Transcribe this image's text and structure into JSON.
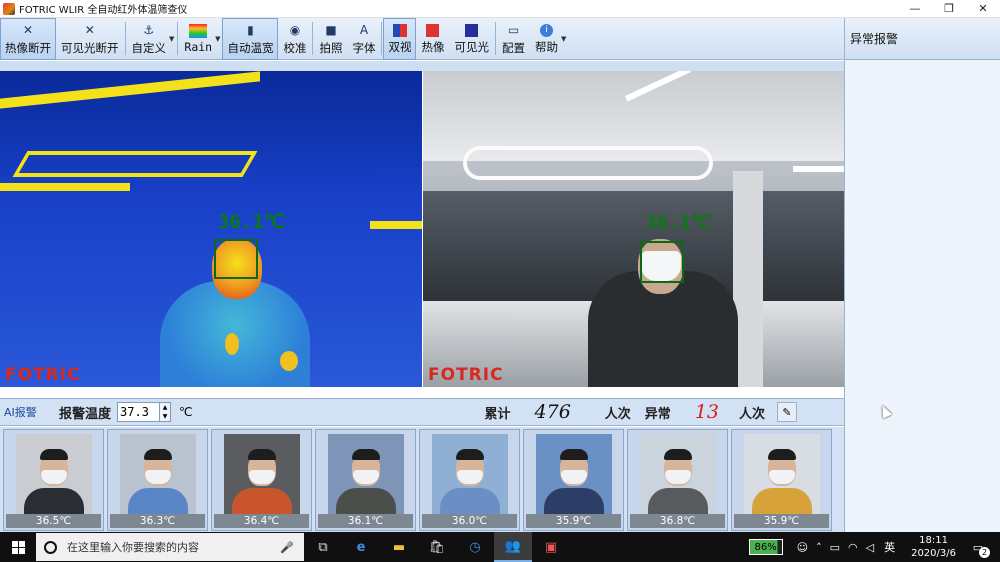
{
  "window": {
    "title": "FOTRIC WLIR 全自动红外体温筛查仪",
    "controls": [
      "—",
      "❐",
      "✕"
    ]
  },
  "toolbar": {
    "buttons": [
      {
        "label": "热像断开",
        "icon": "disconnect-icon",
        "active": true
      },
      {
        "label": "可见光断开",
        "icon": "disconnect-icon",
        "active": false
      },
      {
        "label": "自定义",
        "icon": "anchor-icon",
        "active": false
      },
      {
        "label": "Rain",
        "icon": "palette-rain-icon",
        "active": false
      },
      {
        "label": "自动温宽",
        "icon": "auto-span-icon",
        "active": true
      },
      {
        "label": "校准",
        "icon": "calibrate-icon",
        "active": false
      },
      {
        "label": "拍照",
        "icon": "camera-icon",
        "active": false
      },
      {
        "label": "字体",
        "icon": "font-icon",
        "active": false
      },
      {
        "label": "双视",
        "icon": "dual-view-icon",
        "active": true
      },
      {
        "label": "热像",
        "icon": "thermal-view-icon",
        "active": false
      },
      {
        "label": "可见光",
        "icon": "visible-view-icon",
        "active": false
      },
      {
        "label": "配置",
        "icon": "monitor-icon",
        "active": false
      },
      {
        "label": "帮助",
        "icon": "info-icon",
        "active": false
      }
    ]
  },
  "right_panel": {
    "title": "异常报警"
  },
  "thermal_view": {
    "temperature": "36.1℃",
    "brand": "FOTRIC"
  },
  "visible_view": {
    "temperature": "36.1℃",
    "brand": "FOTRIC"
  },
  "alarm": {
    "ai_label": "AI报警",
    "temp_label": "报警温度",
    "temp_value": "37.3",
    "temp_unit": "℃",
    "total_label": "累计",
    "total_count": "476",
    "count_unit": "人次",
    "abnormal_label": "异常",
    "abnormal_count": "13",
    "colors": {
      "total": "#111111",
      "abnormal": "#d81e1e"
    }
  },
  "captures": [
    {
      "temp": "36.5℃",
      "bg": "#c9ccd1",
      "clothes": "#2a2d33",
      "mask": true
    },
    {
      "temp": "36.3℃",
      "bg": "#b8c3cf",
      "clothes": "#5a86c8",
      "mask": true
    },
    {
      "temp": "36.4℃",
      "bg": "#5a5c5f",
      "clothes": "#c9552d",
      "mask": true
    },
    {
      "temp": "36.1℃",
      "bg": "#7e95b8",
      "clothes": "#4a4f4b",
      "mask": true
    },
    {
      "temp": "36.0℃",
      "bg": "#8fb0d4",
      "clothes": "#6b8fc4",
      "mask": true
    },
    {
      "temp": "35.9℃",
      "bg": "#6b90c4",
      "clothes": "#2d3e66",
      "mask": true
    },
    {
      "temp": "36.8℃",
      "bg": "#cbd4dd",
      "clothes": "#585a5e",
      "mask": true
    },
    {
      "temp": "35.9℃",
      "bg": "#d8dde3",
      "clothes": "#d7a23a",
      "mask": true
    }
  ],
  "taskbar": {
    "search_placeholder": "在这里输入你要搜索的内容",
    "battery": "86%",
    "ime": "英",
    "time": "18:11",
    "date": "2020/3/6",
    "notifications": "2"
  }
}
